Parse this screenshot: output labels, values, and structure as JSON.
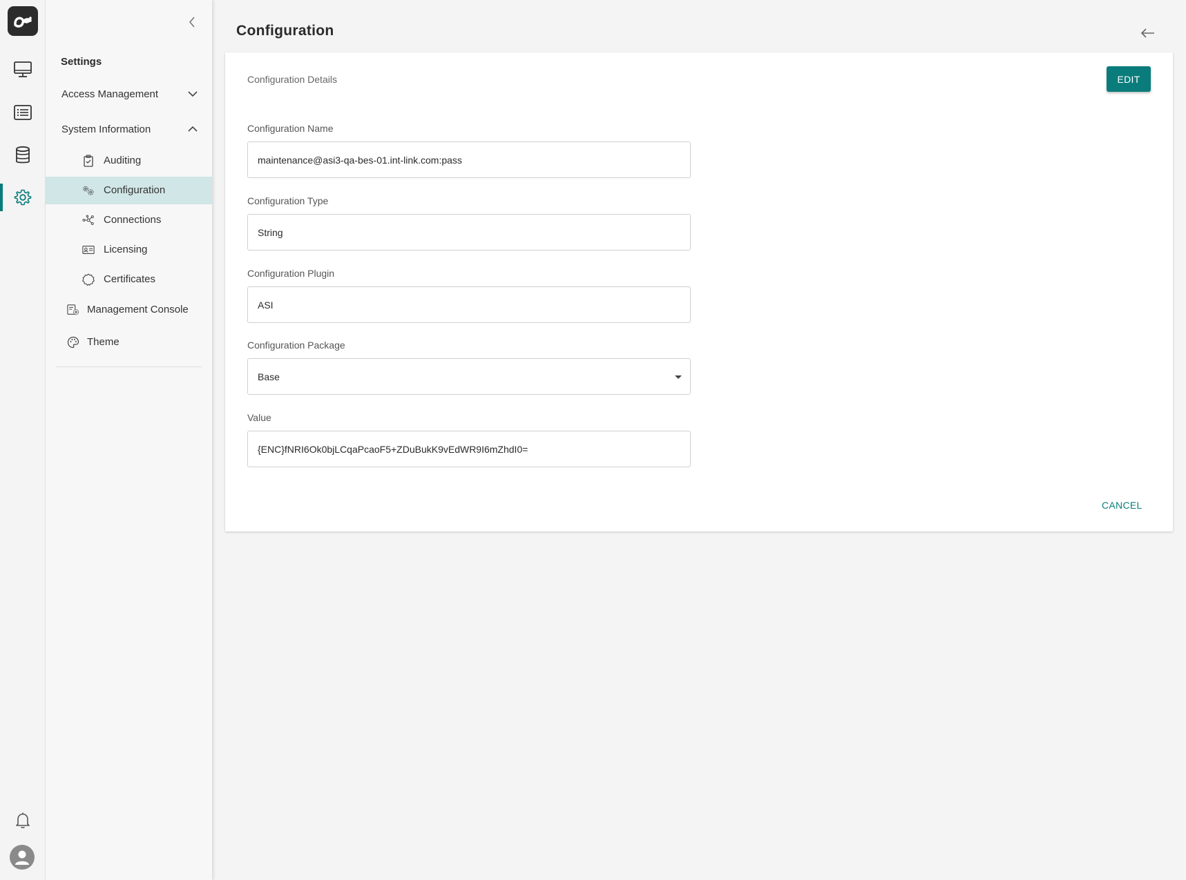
{
  "rail": {
    "items": [
      {
        "name": "monitor-icon"
      },
      {
        "name": "list-icon"
      },
      {
        "name": "database-icon"
      },
      {
        "name": "gear-icon"
      }
    ]
  },
  "sidebar": {
    "title": "Settings",
    "groups": [
      {
        "label": "Access Management",
        "expanded": false
      },
      {
        "label": "System Information",
        "expanded": true
      }
    ],
    "sub_items": [
      {
        "label": "Auditing",
        "icon": "clipboard-check-icon"
      },
      {
        "label": "Configuration",
        "icon": "gears-icon",
        "active": true
      },
      {
        "label": "Connections",
        "icon": "network-icon"
      },
      {
        "label": "Licensing",
        "icon": "id-card-icon"
      },
      {
        "label": "Certificates",
        "icon": "badge-icon"
      }
    ],
    "items": [
      {
        "label": "Management Console",
        "icon": "console-gear-icon"
      },
      {
        "label": "Theme",
        "icon": "palette-icon"
      }
    ]
  },
  "header": {
    "title": "Configuration"
  },
  "card": {
    "section_title": "Configuration Details",
    "edit_label": "EDIT",
    "cancel_label": "CANCEL",
    "fields": {
      "name": {
        "label": "Configuration Name",
        "value": "maintenance@asi3-qa-bes-01.int-link.com:pass"
      },
      "type": {
        "label": "Configuration Type",
        "value": "String"
      },
      "plugin": {
        "label": "Configuration Plugin",
        "value": "ASI"
      },
      "package": {
        "label": "Configuration Package",
        "value": "Base"
      },
      "value": {
        "label": "Value",
        "value": "{ENC}fNRI6Ok0bjLCqaPcaoF5+ZDuBukK9vEdWR9I6mZhdI0="
      }
    }
  },
  "colors": {
    "accent": "#0b7c7c",
    "active_bg": "#d1e6e6",
    "page_bg": "#f4f4f4"
  }
}
